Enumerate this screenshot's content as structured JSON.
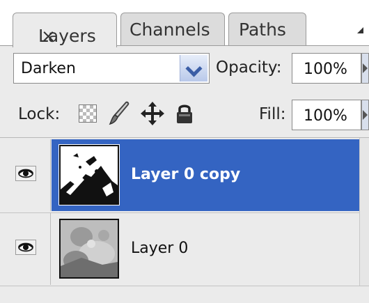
{
  "tabs": [
    {
      "label": "Layers",
      "active": true,
      "close": "×"
    },
    {
      "label": "Channels",
      "active": false
    },
    {
      "label": "Paths",
      "active": false
    }
  ],
  "blend_mode": {
    "value": "Darken"
  },
  "opacity": {
    "label": "Opacity:",
    "value": "100%"
  },
  "lock": {
    "label": "Lock:",
    "icons": [
      "lock-transparent-pixels-icon",
      "lock-image-pixels-icon",
      "lock-position-icon",
      "lock-all-icon"
    ]
  },
  "fill": {
    "label": "Fill:",
    "value": "100%"
  },
  "layers": [
    {
      "name": "Layer 0 copy",
      "selected": true,
      "visible": true
    },
    {
      "name": "Layer 0",
      "selected": false,
      "visible": true
    }
  ],
  "colors": {
    "selection": "#3464c2",
    "panel": "#ebebeb"
  }
}
